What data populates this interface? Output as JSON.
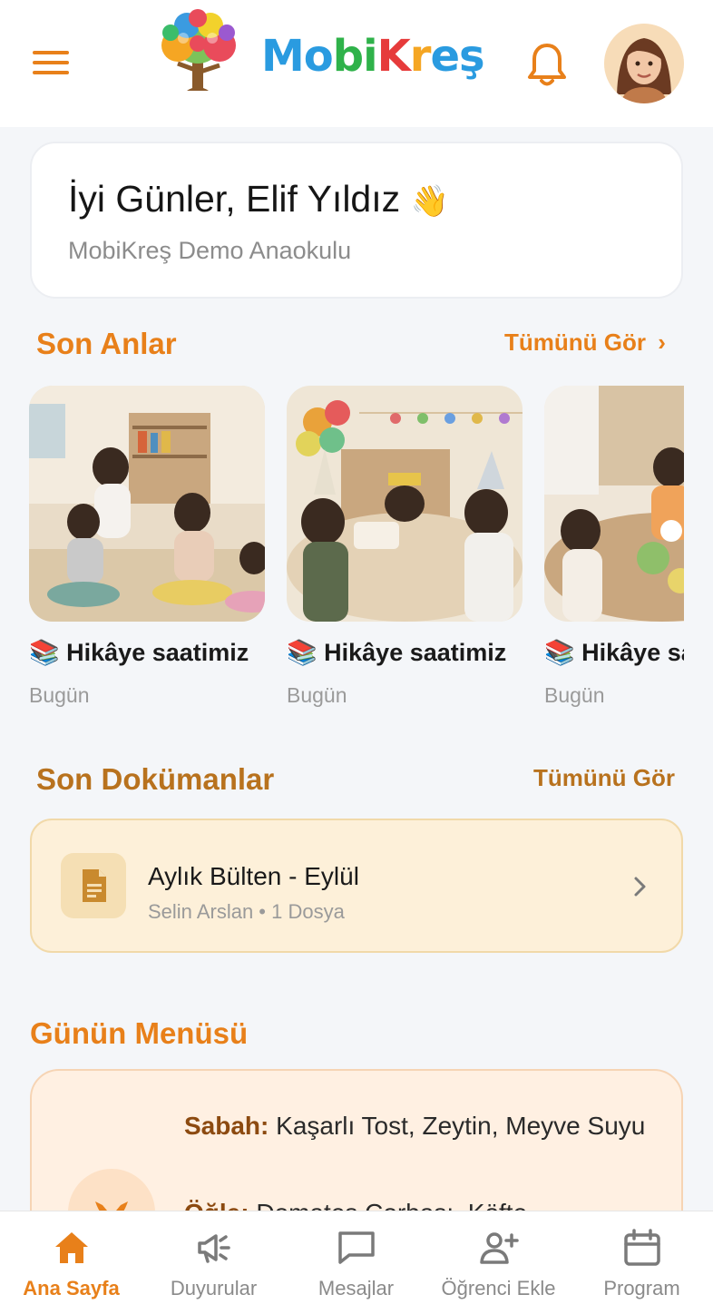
{
  "header": {
    "brand": "MobiKreş",
    "brand_parts": [
      "M",
      "o",
      "b",
      "i",
      "K",
      "r",
      "e",
      "ş"
    ],
    "brand_colors": [
      "#2a9be0",
      "#2a9be0",
      "#2fb24a",
      "#2fb24a",
      "#e63b3b",
      "#f5a623",
      "#2a9be0",
      "#2a9be0"
    ],
    "menu_icon": "hamburger-icon",
    "bell_icon": "bell-icon",
    "accent": "#e8801a"
  },
  "greeting": {
    "title": "İyi Günler, Elif Yıldız",
    "wave": "👋",
    "school": "MobiKreş Demo Anaokulu"
  },
  "moments": {
    "title": "Son Anlar",
    "see_all": "Tümünü Gör",
    "items": [
      {
        "emoji": "📚",
        "caption": "Hikâye saatimiz",
        "date": "Bugün"
      },
      {
        "emoji": "📚",
        "caption": "Hikâye saatimiz",
        "date": "Bugün"
      },
      {
        "emoji": "📚",
        "caption": "Hikâye saatimiz",
        "date": "Bugün"
      }
    ]
  },
  "documents": {
    "title": "Son Dokümanlar",
    "see_all": "Tümünü Gör",
    "items": [
      {
        "title": "Aylık Bülten - Eylül",
        "meta": "Selin Arslan • 1 Dosya"
      }
    ]
  },
  "daily_menu": {
    "title": "Günün Menüsü",
    "breakfast_label": "Sabah:",
    "breakfast": "Kaşarlı Tost, Zeytin, Meyve Suyu",
    "lunch_label": "Öğle:",
    "lunch": "Domates Çorbası, Köfte"
  },
  "bottom_nav": {
    "items": [
      {
        "label": "Ana Sayfa",
        "icon": "home-icon",
        "active": true
      },
      {
        "label": "Duyurular",
        "icon": "megaphone-icon",
        "active": false
      },
      {
        "label": "Mesajlar",
        "icon": "message-icon",
        "active": false
      },
      {
        "label": "Öğrenci Ekle",
        "icon": "add-user-icon",
        "active": false
      },
      {
        "label": "Program",
        "icon": "calendar-icon",
        "active": false
      }
    ]
  }
}
